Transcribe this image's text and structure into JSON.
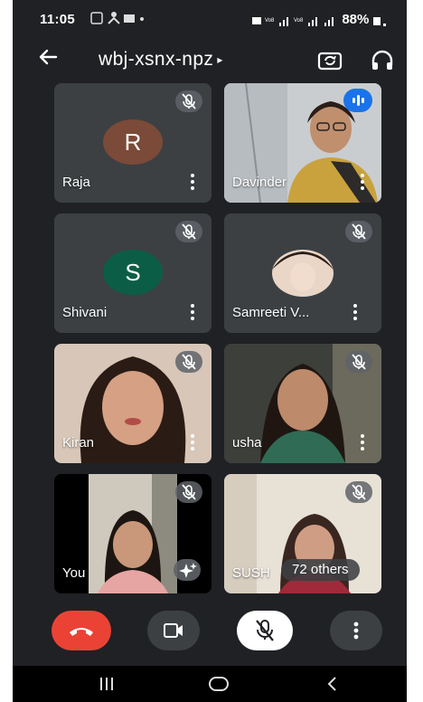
{
  "status_bar": {
    "time": "11:05",
    "battery": "88%"
  },
  "top_bar": {
    "meeting_code": "wbj-xsnx-npz",
    "caret": "▸"
  },
  "participants": [
    {
      "name": "Raja",
      "avatar_letter": "R",
      "avatar_color": "#7b4a38",
      "muted": true
    },
    {
      "name": "Davinder",
      "muted": false,
      "speaking": true
    },
    {
      "name": "Shivani",
      "avatar_letter": "S",
      "avatar_color": "#0b5e45",
      "muted": true
    },
    {
      "name": "Samreeti V...",
      "muted": true
    },
    {
      "name": "Kiran",
      "muted": true
    },
    {
      "name": "usha",
      "muted": true
    },
    {
      "name": "You",
      "muted": true
    },
    {
      "name": "SUSH",
      "muted": true
    }
  ],
  "others": {
    "label": "72 others"
  },
  "colors": {
    "background": "#202124",
    "tile": "#3c4043",
    "end_call": "#ea4335",
    "speaking": "#1a73e8"
  },
  "icons": {
    "back": "arrow-left",
    "camera_switch": "camera-switch-icon",
    "audio_output": "headphones-icon",
    "muted": "mic-off-icon",
    "end_call": "phone-hangup-icon",
    "video": "video-camera-icon",
    "mic": "mic-off-icon",
    "more": "more-vertical-icon"
  }
}
